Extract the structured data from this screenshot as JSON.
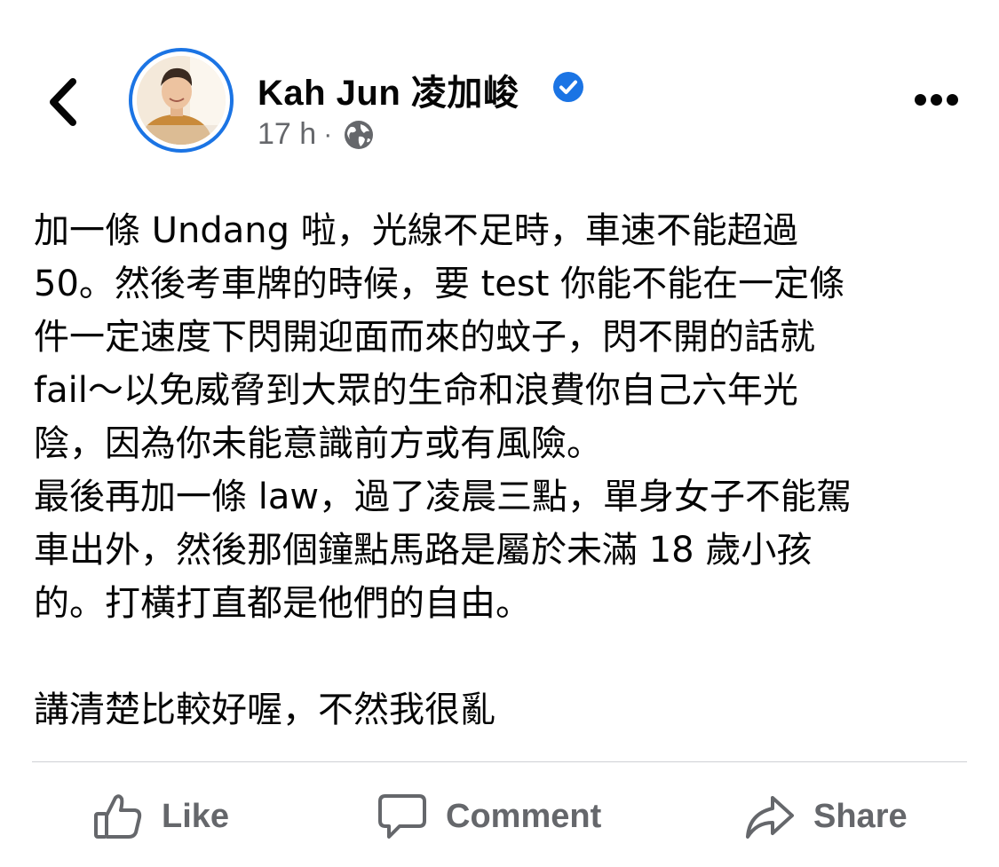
{
  "header": {
    "author_name": "Kah Jun 凌加峻",
    "time": "17 h",
    "separator": "·",
    "audience_icon": "globe-icon",
    "verified_icon": "verified-badge-icon",
    "back_icon": "chevron-left-icon",
    "more_icon": "more-horizontal-icon"
  },
  "post": {
    "lines": [
      "加一條 Undang 啦，光線不足時，車速不能超過",
      "50。然後考車牌的時候，要 test 你能不能在一定條",
      "件一定速度下閃開迎面而來的蚊子，閃不開的話就",
      "fail～以免威脅到大眾的生命和浪費你自己六年光",
      "陰，因為你未能意識前方或有風險。",
      "最後再加一條 law，過了凌晨三點，單身女子不能駕",
      "車出外，然後那個鐘點馬路是屬於未滿 18 歲小孩",
      "的。打橫打直都是他們的自由。",
      "",
      "講清楚比較好喔，不然我很亂"
    ]
  },
  "actions": {
    "like_label": "Like",
    "comment_label": "Comment",
    "share_label": "Share"
  },
  "colors": {
    "accent": "#1b74e4",
    "muted": "#65676b",
    "text": "#050505",
    "divider": "#ced0d4"
  }
}
